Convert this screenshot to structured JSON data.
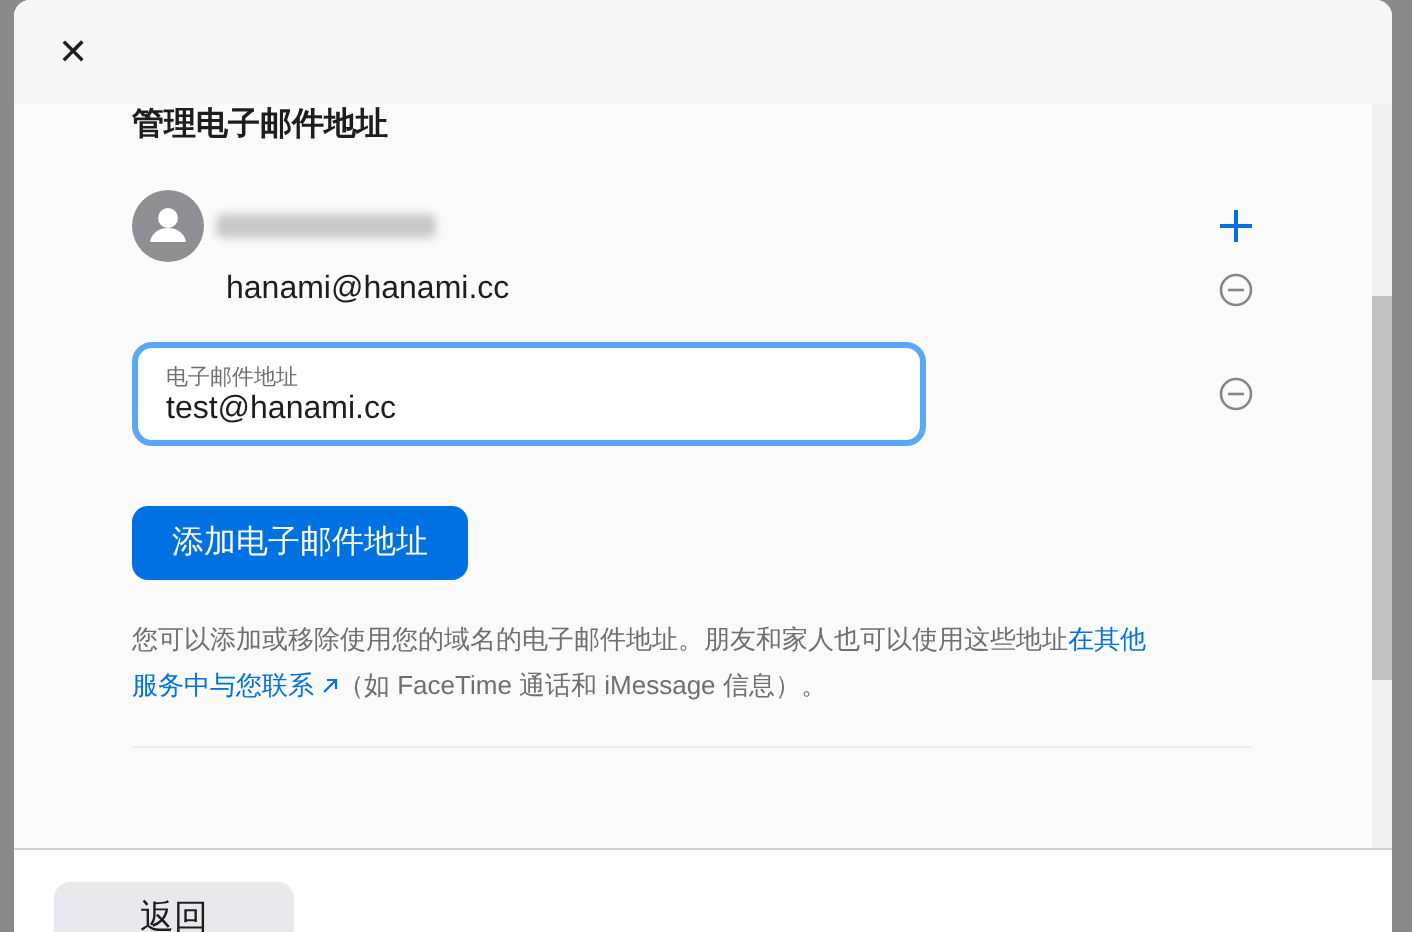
{
  "dialog": {
    "close_icon": "✕",
    "title": "管理电子邮件地址"
  },
  "addresses": [
    {
      "kind": "text",
      "value": "hanami@hanami.cc"
    },
    {
      "kind": "input",
      "label": "电子邮件地址",
      "value": "test@hanami.cc",
      "focused": true
    }
  ],
  "add_button": "添加电子邮件地址",
  "note": {
    "before": "您可以添加或移除使用您的域名的电子邮件地址。朋友和家人也可以使用这些地址",
    "link": [
      "在其他",
      "服务中与您联系"
    ],
    "after": "（如 FaceTime 通话和 iMessage 信息）。"
  },
  "footer": {
    "back_button": "返回"
  }
}
